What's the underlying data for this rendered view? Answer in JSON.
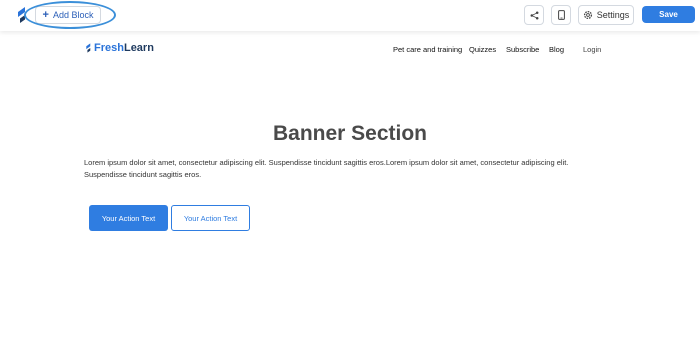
{
  "toolbar": {
    "add_block_label": "Add Block",
    "settings_label": "Settings",
    "save_label": "Save"
  },
  "site": {
    "brand_part1": "Fresh",
    "brand_part2": "Learn",
    "nav": [
      "Pet care and training",
      "Quizzes",
      "Subscribe",
      "Blog"
    ],
    "login_label": "Login"
  },
  "banner": {
    "title": "Banner Section",
    "body": "Lorem ipsum dolor sit amet, consectetur adipiscing elit. Suspendisse tincidunt sagittis eros.Lorem ipsum dolor sit amet, consectetur adipiscing elit. Suspendisse tincidunt sagittis eros.",
    "primary_button": "Your Action Text",
    "secondary_button": "Your Action Text"
  },
  "colors": {
    "accent": "#2f7de1",
    "highlight_ring": "#3b8fd9",
    "title": "#4a4a4a"
  },
  "icons": {
    "app_logo": "freshlearn-logo-icon",
    "add": "plus-icon",
    "share": "share-icon",
    "mobile": "mobile-preview-icon",
    "settings": "gear-icon"
  }
}
